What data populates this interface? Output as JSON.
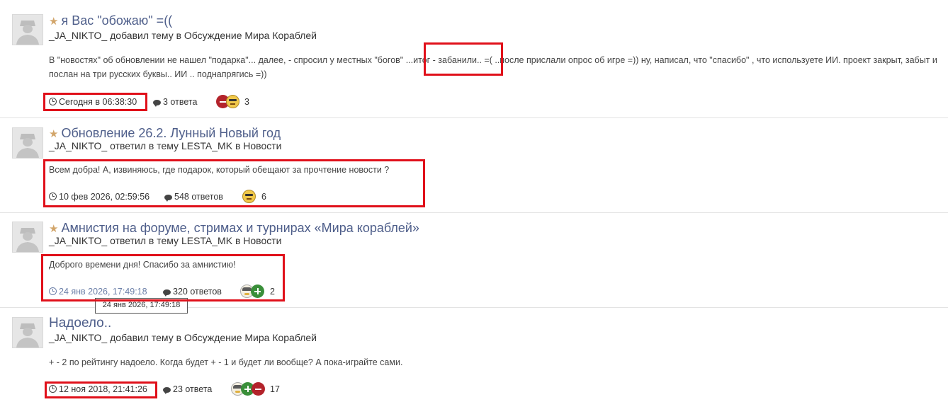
{
  "posts": [
    {
      "title": "я Вас \"обожаю\" =((",
      "starred": true,
      "author": "_JA_NIKTO_",
      "action": "добавил тему в",
      "forum": "Обсуждение Мира Кораблей",
      "snippet": "В \"новостях\" об обновлении не нашел \"подарка\"... далее, - спросил у местных \"богов\" ...итог - забанили.. =( ..после прислали опрос об игре =)) ну, написал, что \"спасибо\" , что используете ИИ. проект закрыт, забыт и послан на три русских буквы.. ИИ .. поднапрягись =))",
      "date": "Сегодня в 06:38:30",
      "replies": "3 ответа",
      "reactions": [
        "minus",
        "face-yellow"
      ],
      "reaction_count": "3"
    },
    {
      "title": "Обновление 26.2. Лунный Новый год",
      "starred": true,
      "author": "_JA_NIKTO_",
      "action": "ответил в тему",
      "forum": "LESTA_MK в Новости",
      "snippet": "Всем добра! А, извиняюсь, где подарок, который обещают за прочтение новости ?",
      "date": "10 фев 2026, 02:59:56",
      "replies": "548 ответов",
      "reactions": [
        "face-yellow"
      ],
      "reaction_count": "6"
    },
    {
      "title": "Амнистия на форуме, стримах и турнирах «Мира кораблей»",
      "starred": true,
      "author": "_JA_NIKTO_",
      "action": "ответил в тему",
      "forum": "LESTA_MK в Новости",
      "snippet": "Доброго времени дня! Спасибо за амнистию!",
      "date": "24 янв 2026, 17:49:18",
      "replies": "320 ответов",
      "reactions": [
        "face-captain",
        "plus"
      ],
      "reaction_count": "2",
      "tooltip": "24 янв 2026, 17:49:18"
    },
    {
      "title": "Надоело..",
      "starred": false,
      "author": "_JA_NIKTO_",
      "action": "добавил тему в",
      "forum": "Обсуждение Мира Кораблей",
      "snippet": "+ - 2 по рейтингу надоело. Когда будет + - 1 и будет ли вообще? А пока-играйте сами.",
      "date": "12 ноя 2018, 21:41:26",
      "replies": "23 ответа",
      "reactions": [
        "face-captain",
        "plus",
        "minus"
      ],
      "reaction_count": "17"
    }
  ],
  "colors": {
    "link": "#4e5e8a",
    "star": "#d2a56a",
    "highlight": "#e0101a"
  }
}
